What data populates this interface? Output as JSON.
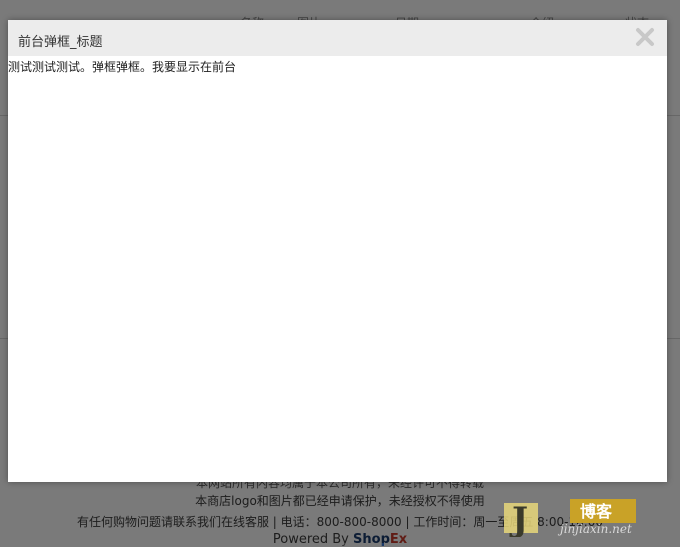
{
  "modal": {
    "title": "前台弹框_标题",
    "close_icon": "close-icon",
    "body_text": "测试测试测试。弹框弹框。我要显示在前台"
  },
  "background": {
    "header_cells": [
      "名称",
      "图片",
      "日期",
      "介绍",
      "状态"
    ],
    "footer": {
      "line1": "本网站所有内容均属于本公司所有，未经许可不得转载",
      "line2": "本商店logo和图片都已经申请保护，未经授权不得使用",
      "line3": "有任何购物问题请联系我们在线客服 | 电话：800-800-8000 | 工作时间：周一至周五 8:00-18:00",
      "powered_prefix": "Powered By ",
      "brand_shop": "Shop",
      "brand_ex": "Ex"
    }
  },
  "watermark": {
    "text_cn": "博客",
    "text_en": "jinjiaxin.net",
    "letter": "J"
  },
  "colors": {
    "overlay": "#7a7a7a",
    "modal_header": "#ececec",
    "close_icon": "#c8c8c8",
    "brand_shop": "#1a3a6a",
    "brand_ex": "#c0392b",
    "watermark_gold": "#c9a227"
  }
}
